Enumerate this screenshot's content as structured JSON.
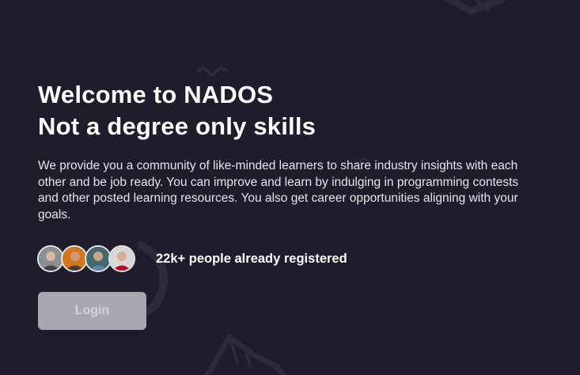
{
  "hero": {
    "title_line1": "Welcome to NADOS",
    "title_line2": "Not a degree only skills",
    "description": "We provide you a community of like-minded learners to share industry insights with each other and be job ready. You can improve and learn by indulging in programming contests and other posted learning resources. You also get career opportunities aligning with your goals."
  },
  "community": {
    "avatar_count": 4,
    "registered_text": "22k+ people already registered"
  },
  "actions": {
    "login_label": "Login"
  },
  "colors": {
    "background": "#1f1c2c",
    "text_primary": "#ffffff",
    "button_disabled": "#a9a7b0"
  }
}
